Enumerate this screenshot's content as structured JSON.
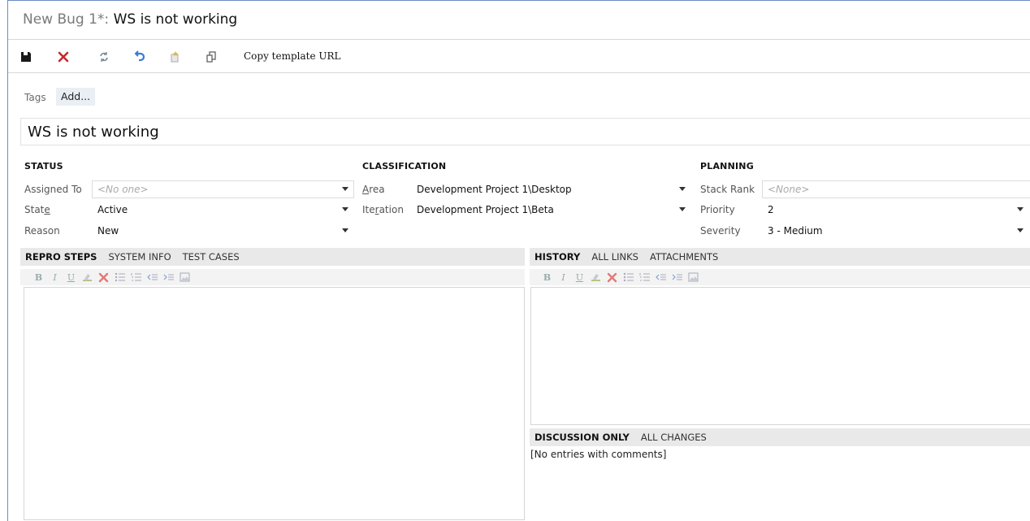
{
  "title": {
    "prefix": "New Bug 1*: ",
    "text": "WS is not working"
  },
  "toolbar": {
    "copy_template_url": "Copy template URL"
  },
  "tags": {
    "label": "Tags",
    "add_label": "Add..."
  },
  "work_item_title": "WS is not working",
  "status": {
    "header": "STATUS",
    "assigned_to_label": "Assigned To",
    "assigned_to_value": "<No one>",
    "state_label_pre": "Stat",
    "state_label_acc": "e",
    "state_value": "Active",
    "reason_label": "Reason",
    "reason_value": "New"
  },
  "classification": {
    "header": "CLASSIFICATION",
    "area_label_acc": "A",
    "area_label_post": "rea",
    "area_value": "Development Project 1\\Desktop",
    "iteration_label_pre": "Ite",
    "iteration_label_acc": "r",
    "iteration_label_post": "ation",
    "iteration_value": "Development Project 1\\Beta"
  },
  "planning": {
    "header": "PLANNING",
    "stack_rank_label": "Stack Rank",
    "stack_rank_value": "<None>",
    "priority_label": "Priority",
    "priority_value": "2",
    "severity_label": "Severity",
    "severity_value": "3 - Medium"
  },
  "left_tabs": [
    "REPRO STEPS",
    "SYSTEM INFO",
    "TEST CASES"
  ],
  "right_tabs": [
    "HISTORY",
    "ALL LINKS",
    "ATTACHMENTS"
  ],
  "discussion_tabs": [
    "DISCUSSION ONLY",
    "ALL CHANGES"
  ],
  "no_entries_text": "[No entries with comments]",
  "colors": {
    "accent_border": "#6b8cc5",
    "delete_red": "#c8282d",
    "undo_blue": "#3a7bd5"
  }
}
